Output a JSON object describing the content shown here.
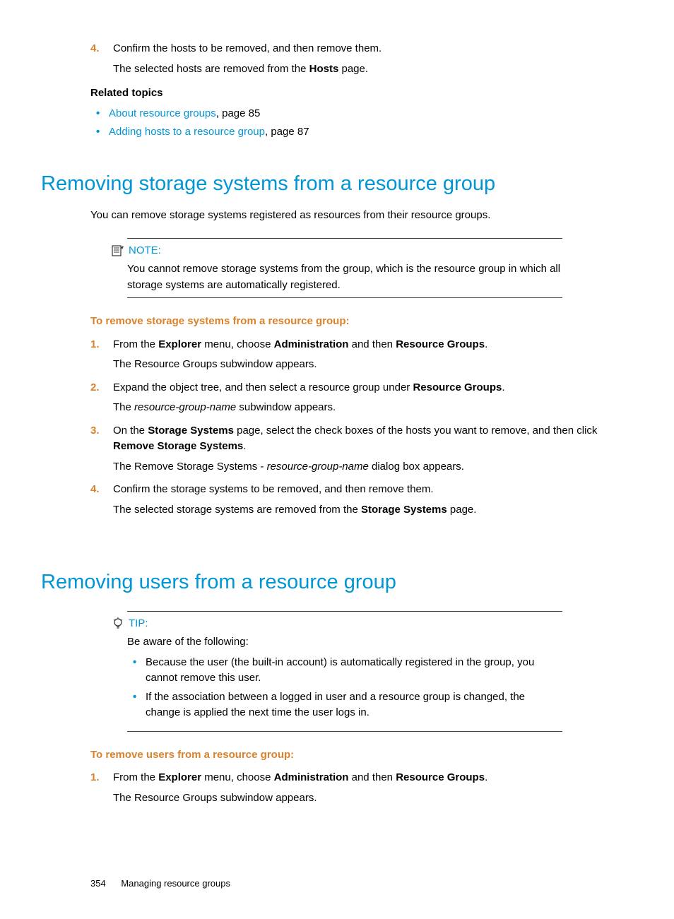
{
  "top": {
    "step4_num": "4.",
    "step4_a": "Confirm the hosts to be removed, and then remove them.",
    "step4_b_pre": "The selected hosts are removed from the ",
    "step4_b_bold": "Hosts",
    "step4_b_post": " page.",
    "related_heading": "Related topics",
    "rel1_link": "About resource groups",
    "rel1_post": ", page 85",
    "rel2_link": "Adding hosts to a resource group",
    "rel2_post": ", page 87"
  },
  "sec1": {
    "title": "Removing storage systems from a resource group",
    "intro": "You can remove storage systems registered as resources from their resource groups.",
    "note_label": "NOTE:",
    "note_body": "You cannot remove storage systems from the                                        group, which is the resource group in which all storage systems are automatically registered.",
    "proc_heading": "To remove storage systems from a resource group:",
    "steps": {
      "s1_num": "1.",
      "s1_pre": "From the ",
      "s1_b1": "Explorer",
      "s1_mid1": " menu, choose ",
      "s1_b2": "Administration",
      "s1_mid2": " and then ",
      "s1_b3": "Resource Groups",
      "s1_post": ".",
      "s1_sub": "The Resource Groups subwindow appears.",
      "s2_num": "2.",
      "s2_pre": "Expand the object tree, and then select a resource group under ",
      "s2_b1": "Resource Groups",
      "s2_post": ".",
      "s2_sub_pre": "The ",
      "s2_sub_i": "resource-group-name",
      "s2_sub_post": " subwindow appears.",
      "s3_num": "3.",
      "s3_pre": "On the ",
      "s3_b1": "Storage Systems",
      "s3_mid": " page, select the check boxes of the hosts you want to remove, and then click ",
      "s3_b2": "Remove Storage Systems",
      "s3_post": ".",
      "s3_sub_pre": "The Remove Storage Systems - ",
      "s3_sub_i": "resource-group-name",
      "s3_sub_post": " dialog box appears.",
      "s4_num": "4.",
      "s4_a": "Confirm the storage systems to be removed, and then remove them.",
      "s4_b_pre": "The selected storage systems are removed from the ",
      "s4_b_bold": "Storage Systems",
      "s4_b_post": " page."
    }
  },
  "sec2": {
    "title": "Removing users from a resource group",
    "tip_label": "TIP:",
    "tip_intro": "Be aware of the following:",
    "tip_b1": "Because the user                 (the built-in account) is automatically registered in the                           group, you cannot remove this user.",
    "tip_b2": "If the association between a logged in user and a resource group is changed, the change is applied the next time the user logs in.",
    "proc_heading": "To remove users from a resource group:",
    "steps": {
      "s1_num": "1.",
      "s1_pre": "From the ",
      "s1_b1": "Explorer",
      "s1_mid1": " menu, choose ",
      "s1_b2": "Administration",
      "s1_mid2": " and then ",
      "s1_b3": "Resource Groups",
      "s1_post": ".",
      "s1_sub": "The Resource Groups subwindow appears."
    }
  },
  "footer": {
    "pagenum": "354",
    "section": "Managing resource groups"
  }
}
